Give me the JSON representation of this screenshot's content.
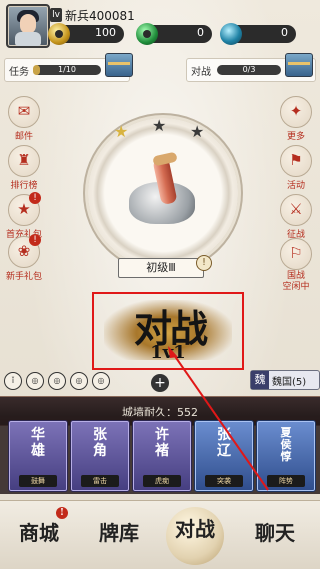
{
  "player": {
    "level_badge": "lv",
    "name": "新兵400081"
  },
  "resources": [
    {
      "name": "coin-icon",
      "value": "100"
    },
    {
      "name": "jade-icon",
      "value": "0"
    },
    {
      "name": "gem-icon",
      "value": "0"
    }
  ],
  "mission": {
    "label": "任务",
    "progress": "1/10",
    "fraction": 0.1
  },
  "battle_progress": {
    "label": "对战",
    "progress": "0/3",
    "fraction": 0.0
  },
  "left_buttons": [
    {
      "label": "邮件",
      "icon": "mail-icon",
      "badge": ""
    },
    {
      "label": "排行榜",
      "icon": "ranking-icon",
      "badge": ""
    },
    {
      "label": "首充礼包",
      "icon": "first-pay-gift-icon",
      "badge": "!"
    },
    {
      "label": "新手礼包",
      "icon": "newbie-gift-icon",
      "badge": "!"
    }
  ],
  "right_buttons": [
    {
      "label": "更多",
      "icon": "more-icon",
      "badge": ""
    },
    {
      "label": "活动",
      "icon": "event-icon",
      "badge": ""
    },
    {
      "label": "征战",
      "icon": "campaign-icon",
      "badge": ""
    },
    {
      "label": "国战\n空闲中",
      "icon": "nation-war-icon",
      "badge": ""
    }
  ],
  "rank": {
    "stars_filled": 1,
    "stars_total": 3,
    "name": "初级Ⅲ",
    "info": "!"
  },
  "battle_button": {
    "title": "对战",
    "mode": "1v1"
  },
  "camp": {
    "tag": "魏",
    "name": "魏国(5)"
  },
  "wall": {
    "label": "城墙耐久：552"
  },
  "heroes": [
    {
      "name": "华\n雄",
      "skill": "鼓舞"
    },
    {
      "name": "张\n角",
      "skill": "雷击"
    },
    {
      "name": "许\n褚",
      "skill": "虎痴"
    },
    {
      "name": "张\n辽",
      "skill": "突袭"
    },
    {
      "name": "夏\n侯\n惇",
      "skill": "阵势"
    }
  ],
  "nav": [
    {
      "label": "商城",
      "badge": "!"
    },
    {
      "label": "牌库",
      "badge": ""
    },
    {
      "label": "对战",
      "badge": ""
    },
    {
      "label": "聊天",
      "badge": ""
    }
  ],
  "colors": {
    "accent_red": "#b52e1f",
    "highlight_box": "#e01818"
  }
}
